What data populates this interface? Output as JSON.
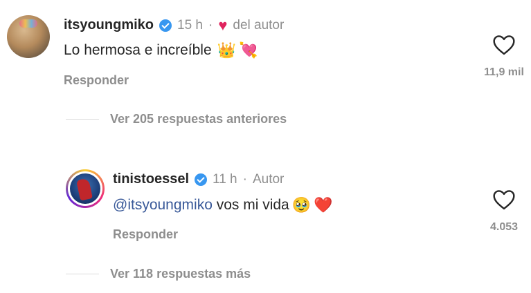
{
  "comments": [
    {
      "username": "itsyoungmiko",
      "time": "15 h",
      "author_tag": "del autor",
      "text": "Lo hermosa e increíble",
      "emoji": [
        "👑",
        "💘"
      ],
      "reply_label": "Responder",
      "likes": "11,9 mil",
      "avatar_icon": "profile-photo-cat",
      "more_replies": "Ver 205 respuestas anteriores"
    },
    {
      "username": "tinistoessel",
      "time": "11 h",
      "author_tag": "Autor",
      "mention": "@itsyoungmiko",
      "text": " vos mi vida",
      "emoji": [
        "🥹",
        "❤️"
      ],
      "reply_label": "Responder",
      "likes": "4.053",
      "avatar_icon": "profile-photo-story-ring",
      "more_replies": "Ver 118 respuestas más"
    }
  ],
  "colors": {
    "verified": "#3897f0",
    "mention": "#385898",
    "liked_by_author_heart": "#e0245e",
    "secondary_text": "#8e8e8e"
  }
}
